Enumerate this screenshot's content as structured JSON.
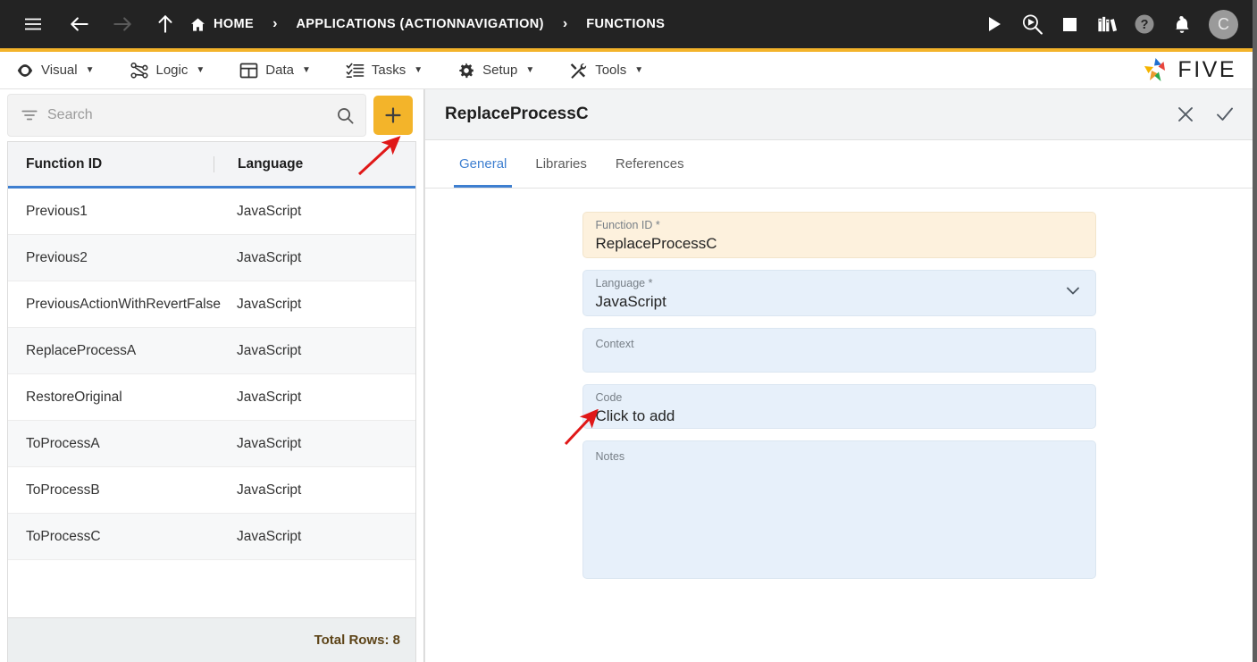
{
  "topbar": {
    "menu_icon": "hamburger-icon",
    "back_icon": "arrow-left-icon",
    "forward_icon": "arrow-right-icon",
    "up_icon": "arrow-up-icon",
    "home_icon": "home-icon",
    "breadcrumbs": [
      {
        "label": "HOME",
        "icon": "home-icon"
      },
      {
        "label": "APPLICATIONS (ACTIONNAVIGATION)",
        "icon": ""
      },
      {
        "label": "FUNCTIONS",
        "icon": ""
      }
    ],
    "separator": "›",
    "actions": [
      {
        "name": "run-icon"
      },
      {
        "name": "debug-icon"
      },
      {
        "name": "stop-icon"
      },
      {
        "name": "library-icon"
      },
      {
        "name": "help-icon"
      },
      {
        "name": "notifications-icon"
      }
    ],
    "avatar_initial": "C",
    "accent_color": "#f3b32a",
    "background_color": "#232323"
  },
  "menubar": {
    "items": [
      {
        "label": "Visual",
        "icon": "eye-icon",
        "caret": "▼"
      },
      {
        "label": "Logic",
        "icon": "nodes-icon",
        "caret": "▼"
      },
      {
        "label": "Data",
        "icon": "table-icon",
        "caret": "▼"
      },
      {
        "label": "Tasks",
        "icon": "checklist-icon",
        "caret": "▼"
      },
      {
        "label": "Setup",
        "icon": "gear-icon",
        "caret": "▼"
      },
      {
        "label": "Tools",
        "icon": "tools-icon",
        "caret": "▼"
      }
    ],
    "brand": "FIVE"
  },
  "left_panel": {
    "search": {
      "placeholder": "Search",
      "value": "",
      "filter_icon": "filter-icon",
      "search_icon": "search-icon"
    },
    "add_button": {
      "icon": "plus-icon",
      "color": "#f3b42a"
    },
    "table": {
      "columns": [
        "Function ID",
        "Language"
      ],
      "rows": [
        {
          "function_id": "Previous1",
          "language": "JavaScript"
        },
        {
          "function_id": "Previous2",
          "language": "JavaScript"
        },
        {
          "function_id": "PreviousActionWithRevertFalse",
          "language": "JavaScript"
        },
        {
          "function_id": "ReplaceProcessA",
          "language": "JavaScript"
        },
        {
          "function_id": "RestoreOriginal",
          "language": "JavaScript"
        },
        {
          "function_id": "ToProcessA",
          "language": "JavaScript"
        },
        {
          "function_id": "ToProcessB",
          "language": "JavaScript"
        },
        {
          "function_id": "ToProcessC",
          "language": "JavaScript"
        }
      ],
      "footer": "Total Rows: 8"
    }
  },
  "right_panel": {
    "title": "ReplaceProcessC",
    "close_icon": "close-icon",
    "confirm_icon": "check-icon",
    "tabs": [
      {
        "label": "General",
        "active": true
      },
      {
        "label": "Libraries",
        "active": false
      },
      {
        "label": "References",
        "active": false
      }
    ],
    "fields": [
      {
        "label": "Function ID *",
        "value": "ReplaceProcessC",
        "style": "cream"
      },
      {
        "label": "Language *",
        "value": "JavaScript",
        "style": "blue",
        "dropdown_icon": "chevron-down-icon"
      },
      {
        "label": "Context",
        "value": "",
        "style": "blue"
      },
      {
        "label": "Code",
        "value": "Click to add",
        "style": "blue"
      },
      {
        "label": "Notes",
        "value": "",
        "style": "blue"
      }
    ]
  },
  "annotations": [
    {
      "name": "arrow-to-add-button",
      "color": "#e01818"
    },
    {
      "name": "arrow-to-code-field",
      "color": "#e01818"
    }
  ]
}
